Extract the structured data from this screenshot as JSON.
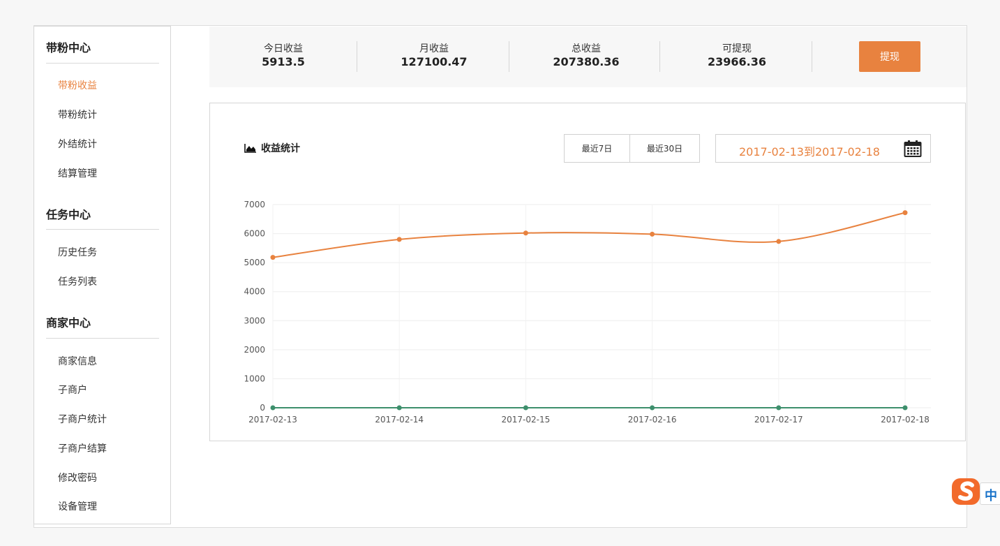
{
  "sidebar": {
    "sections": [
      {
        "title": "带粉中心",
        "items": [
          "带粉收益",
          "带粉统计",
          "外结统计",
          "结算管理"
        ]
      },
      {
        "title": "任务中心",
        "items": [
          "历史任务",
          "任务列表"
        ]
      },
      {
        "title": "商家中心",
        "items": [
          "商家信息",
          "子商户",
          "子商户统计",
          "子商户结算",
          "修改密码",
          "设备管理"
        ]
      }
    ],
    "active_item": "带粉收益"
  },
  "stats": [
    {
      "label": "今日收益",
      "value": "5913.5"
    },
    {
      "label": "月收益",
      "value": "127100.47"
    },
    {
      "label": "总收益",
      "value": "207380.36"
    },
    {
      "label": "可提现",
      "value": "23966.36"
    }
  ],
  "withdraw_label": "提现",
  "panel": {
    "title": "收益统计",
    "title_icon": "area-chart-icon",
    "range_7_label": "最近7日",
    "range_30_label": "最近30日",
    "date_range": "2017-02-13到2017-02-18",
    "calendar_icon": "calendar-icon"
  },
  "ime": {
    "label": "中"
  },
  "colors": {
    "accent": "#e8823f",
    "series_green": "#3d8f6c"
  },
  "chart_data": {
    "type": "line",
    "categories": [
      "2017-02-13",
      "2017-02-14",
      "2017-02-15",
      "2017-02-16",
      "2017-02-17",
      "2017-02-18"
    ],
    "series": [
      {
        "values": [
          5180,
          5800,
          6020,
          5980,
          5730,
          6720
        ],
        "color": "#e8823f"
      },
      {
        "values": [
          0,
          0,
          0,
          0,
          0,
          0
        ],
        "color": "#3d8f6c"
      }
    ],
    "yticks": [
      0,
      1000,
      2000,
      3000,
      4000,
      5000,
      6000,
      7000
    ],
    "ylim": [
      0,
      7000
    ],
    "grid": true,
    "smooth": true,
    "title": "",
    "xlabel": "",
    "ylabel": ""
  }
}
